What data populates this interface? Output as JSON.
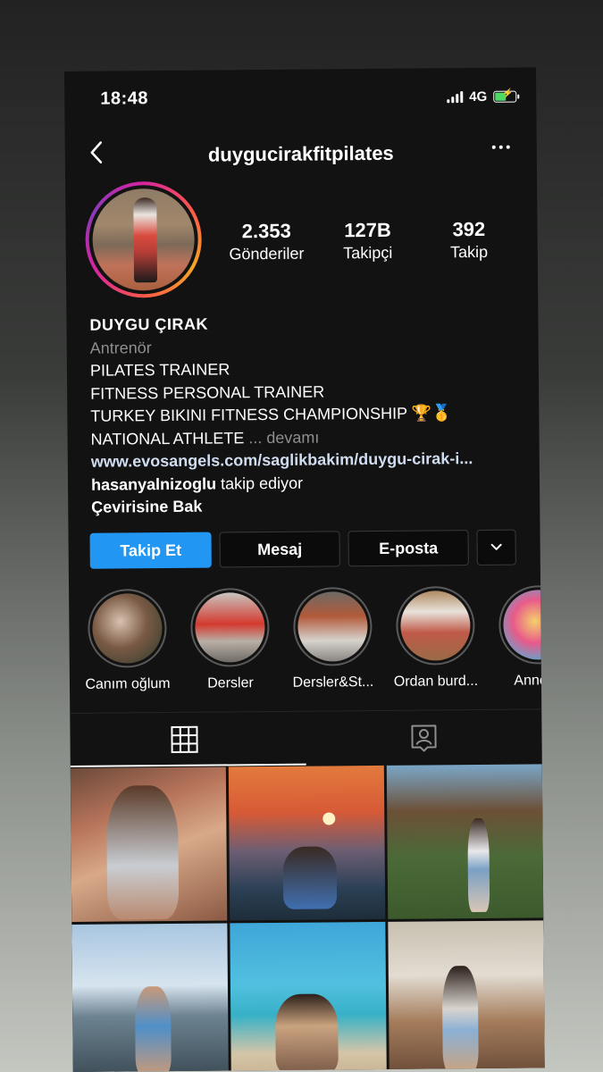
{
  "status_bar": {
    "time": "18:48",
    "network": "4G"
  },
  "header": {
    "username": "duygucirakfitpilates"
  },
  "stats": [
    {
      "value": "2.353",
      "label": "Gönderiler"
    },
    {
      "value": "127B",
      "label": "Takipçi"
    },
    {
      "value": "392",
      "label": "Takip"
    }
  ],
  "bio": {
    "name": "DUYGU ÇIRAK",
    "category": "Antrenör",
    "line1": "PILATES TRAINER",
    "line2": "FITNESS PERSONAL TRAINER",
    "line3": "TURKEY BIKINI FITNESS CHAMPIONSHIP 🏆🥇",
    "line4": "NATIONAL ATHLETE",
    "more": "... devamı",
    "link": "www.evosangels.com/saglikbakim/duygu-cirak-i...",
    "followed_by_user": "hasanyalnizoglu",
    "followed_by_text": " takip ediyor",
    "translate": "Çevirisine Bak"
  },
  "actions": {
    "follow": "Takip Et",
    "message": "Mesaj",
    "email": "E-posta"
  },
  "highlights": [
    {
      "label": "Canım oğlum"
    },
    {
      "label": "Dersler"
    },
    {
      "label": "Dersler&St..."
    },
    {
      "label": "Ordan burd..."
    },
    {
      "label": "Anneoğ"
    }
  ],
  "icons": {
    "back": "chevron-left-icon",
    "more": "ellipsis-icon",
    "grid": "grid-icon",
    "tagged": "tagged-person-icon",
    "dropdown": "chevron-down-icon"
  },
  "colors": {
    "follow_button": "#2196f3",
    "background": "#121212"
  }
}
